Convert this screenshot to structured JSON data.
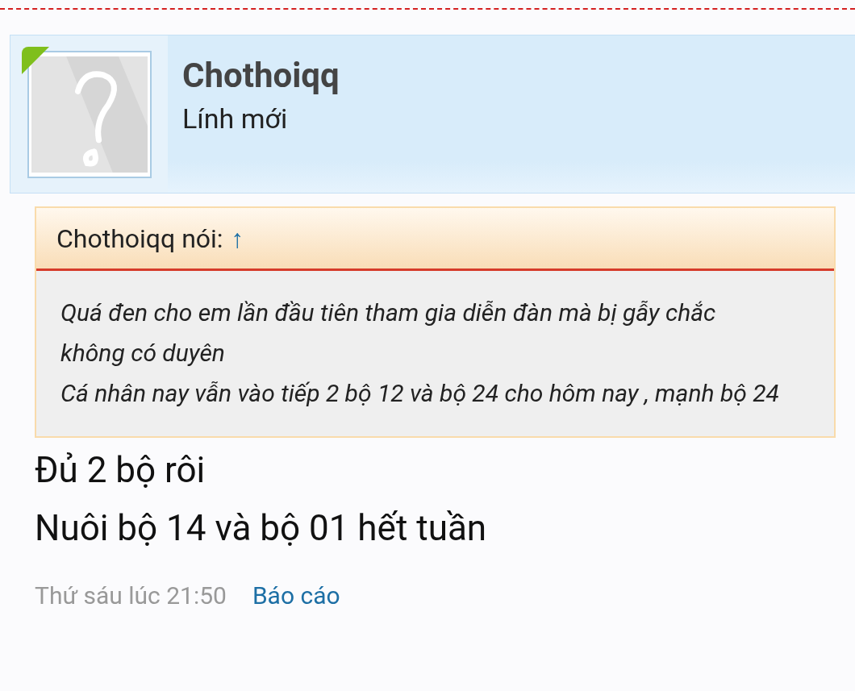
{
  "author": {
    "name": "Chothoiqq",
    "title": "Lính mới",
    "online": true
  },
  "quote": {
    "attribution": "Chothoiqq nói:",
    "jump": "↑",
    "lines": [
      "Quá đen cho em lần đầu tiên tham gia diễn đàn mà bị gẫy chắc không có duyên",
      "Cá nhân nay vẫn vào tiếp 2 bộ 12 và bộ 24 cho hôm nay , mạnh bộ 24"
    ]
  },
  "message": [
    "Đủ 2 bộ rôi",
    "Nuôi bộ 14 và bộ 01 hết tuần"
  ],
  "footer": {
    "date": "Thứ sáu lúc 21:50",
    "report": "Báo cáo"
  }
}
